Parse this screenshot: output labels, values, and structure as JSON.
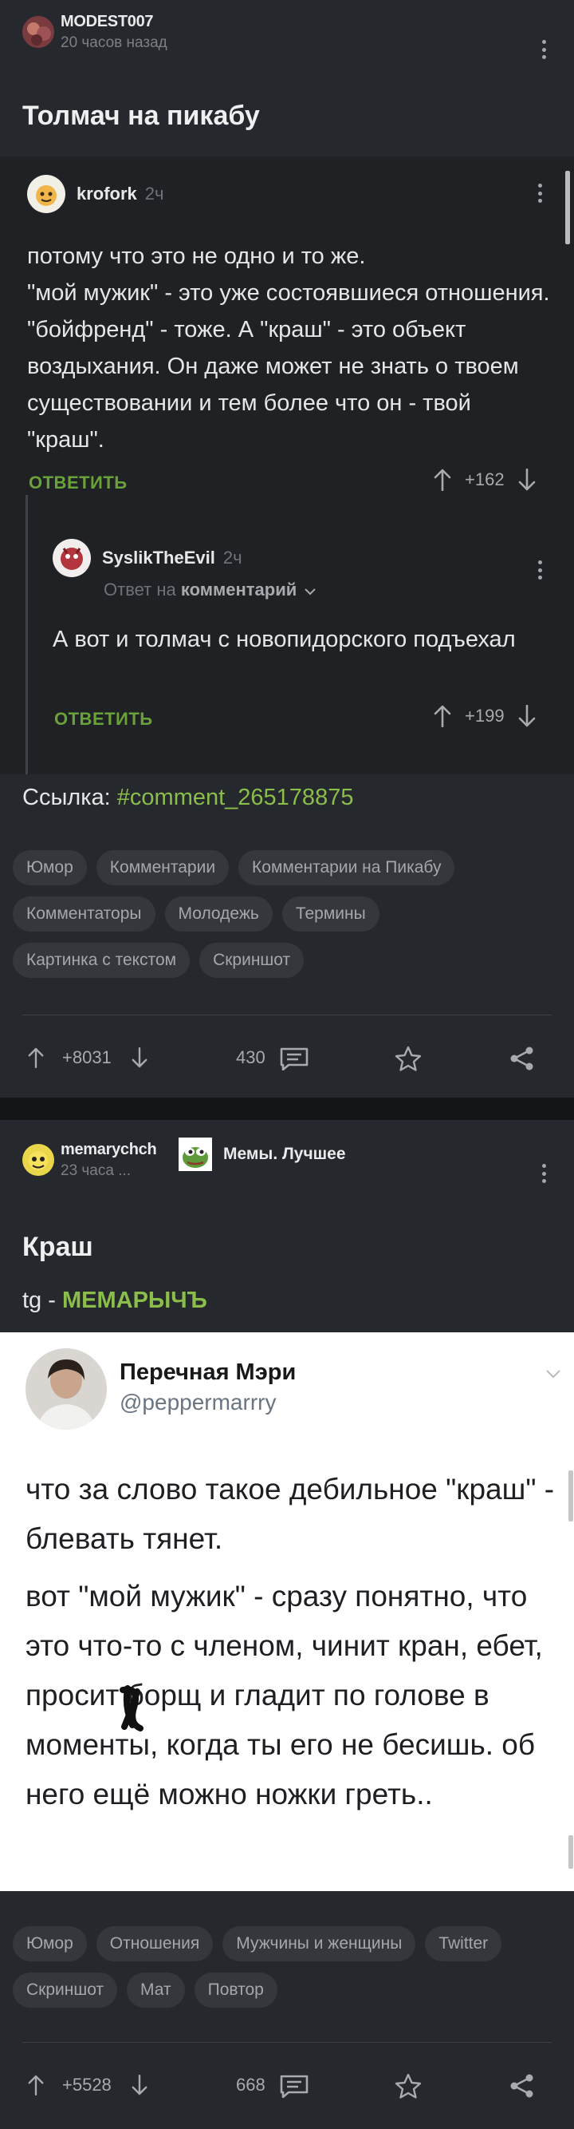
{
  "post1": {
    "author": {
      "name": "MODEST007",
      "time": "20 часов назад"
    },
    "title": "Толмач на пикабу",
    "comment": {
      "author": "krofork",
      "time": "2ч",
      "text": "потому что это не одно и то же.\n\"мой мужик\" - это уже состоявшиеся отношения. \"бойфренд\" - тоже. А \"краш\" - это объект воздыхания. Он даже может не знать о твоем существовании и тем более что он - твой \"краш\".",
      "reply_label": "ОТВЕТИТЬ",
      "rating": "+162"
    },
    "reply": {
      "author": "SyslikTheEvil",
      "time": "2ч",
      "sub_prefix": "Ответ на",
      "sub_target": "комментарий",
      "text": "А вот и толмач с новопидорского подъехал",
      "reply_label": "ОТВЕТИТЬ",
      "rating": "+199"
    },
    "link_label": "Ссылка:",
    "link_value": "#comment_265178875",
    "tags": [
      "Юмор",
      "Комментарии",
      "Комментарии на Пикабу",
      "Комментаторы",
      "Молодежь",
      "Термины",
      "Картинка с текстом",
      "Скриншот"
    ],
    "footer": {
      "rating": "+8031",
      "comments": "430"
    }
  },
  "post2": {
    "author": {
      "name": "memarychch",
      "time": "23 часа ..."
    },
    "community": "Мемы. Лучшее",
    "title": "Краш",
    "tg_prefix": "tg -",
    "tg_channel": "МЕМАРЫЧЪ",
    "tweet": {
      "name": "Перечная Мэри",
      "handle": "@peppermarrry",
      "para1": "что за слово такое дебильное \"краш\" - блевать тянет.",
      "para2": "вот \"мой мужик\" - сразу понятно, что это что-то с членом, чинит кран, ебет, просит борщ и гладит по голове в моменты, когда ты его не бесишь. об него ещё можно ножки греть.."
    },
    "tags": [
      "Юмор",
      "Отношения",
      "Мужчины и женщины",
      "Twitter",
      "Скриншот",
      "Мат",
      "Повтор"
    ],
    "footer": {
      "rating": "+5528",
      "comments": "668"
    }
  },
  "colors": {
    "background": "#25282d",
    "card": "#1f2125",
    "accent_green": "#8bbd4a",
    "separator": "#141517"
  },
  "icons": [
    "arrow-up-icon",
    "arrow-down-icon",
    "comment-icon",
    "star-icon",
    "share-icon",
    "kebab-menu-icon",
    "chevron-down-icon"
  ]
}
